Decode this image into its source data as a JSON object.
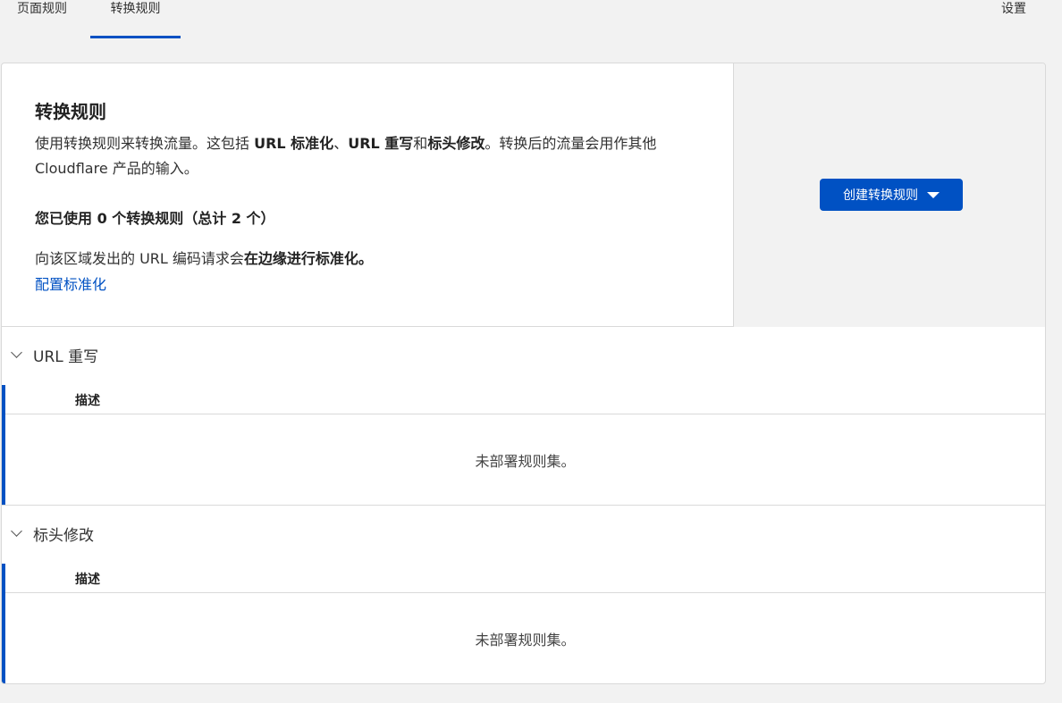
{
  "tabs": {
    "page_rules": "页面规则",
    "transform_rules": "转换规则",
    "settings": "设置"
  },
  "hero": {
    "title": "转换规则",
    "desc_part1": "使用转换规则来转换流量。这包括 ",
    "desc_bold1": "URL 标准化",
    "desc_sep1": "、",
    "desc_bold2": "URL 重写",
    "desc_sep2": "和",
    "desc_bold3": "标头修改",
    "desc_part2": "。转换后的流量会用作其他 Cloudflare 产品的输入。",
    "usage": "您已使用 0 个转换规则（总计 2 个）",
    "normalization_text": "向该区域发出的 URL 编码请求会",
    "normalization_bold": "在边缘进行标准化。",
    "normalization_link": "配置标准化",
    "create_button": "创建转换规则"
  },
  "sections": [
    {
      "title": "URL 重写",
      "column_header": "描述",
      "empty_message": "未部署规则集。"
    },
    {
      "title": "标头修改",
      "column_header": "描述",
      "empty_message": "未部署规则集。"
    }
  ],
  "colors": {
    "accent": "#0051c3",
    "background": "#f2f2f2",
    "border": "#d9d9d9"
  },
  "icons": {
    "create_dropdown": "caret-down-icon",
    "section_toggle": "chevron-down-icon"
  }
}
